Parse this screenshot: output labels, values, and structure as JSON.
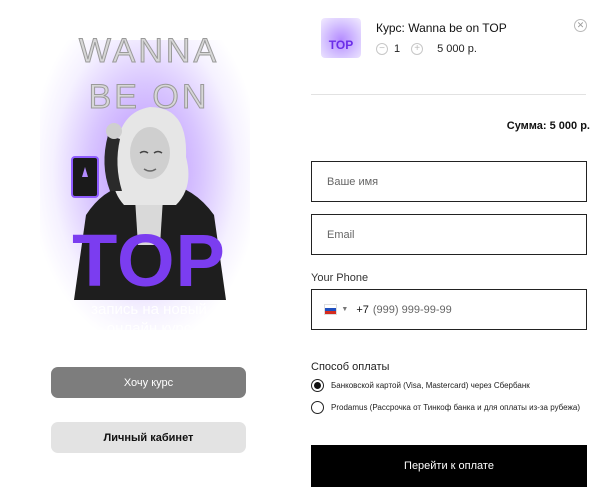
{
  "hero": {
    "line1": "WANNA",
    "line2": "BE ON",
    "big_word": "TOP",
    "subtitle_line1": "запись на новый",
    "subtitle_line2": "онлайн курс",
    "want_button": "Хочу курс",
    "cabinet_button": "Личный кабинет",
    "accent_color": "#7b3df0"
  },
  "cart": {
    "item_title": "Курс: Wanna be on TOP",
    "thumb_text": "TOP",
    "quantity": "1",
    "price": "5 000 р.",
    "total": "Сумма: 5 000 р."
  },
  "form": {
    "name_placeholder": "Ваше имя",
    "email_placeholder": "Email",
    "phone_label": "Your Phone",
    "phone_dial_code": "+7",
    "phone_placeholder": "(999) 999-99-99",
    "country_flag": "russia-flag-icon"
  },
  "payment": {
    "label": "Способ оплаты",
    "options": [
      {
        "label": "Банковской картой (Visa, Mastercard) через Сбербанк",
        "selected": true
      },
      {
        "label": "Prodamus (Рассрочка от Тинкоф банка и для оплаты из-за рубежа)",
        "selected": false
      }
    ],
    "submit": "Перейти к оплате"
  }
}
